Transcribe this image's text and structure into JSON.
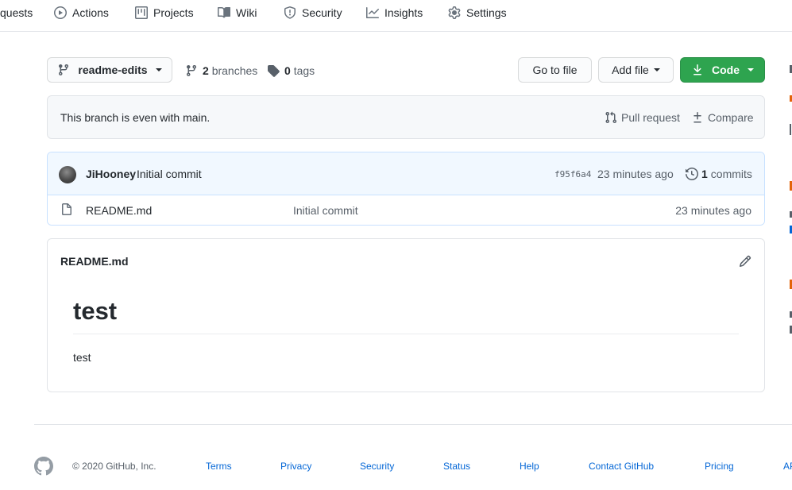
{
  "repo_nav": {
    "items": [
      {
        "label": "quests",
        "icon": "pull-request-icon"
      },
      {
        "label": "Actions",
        "icon": "play-icon"
      },
      {
        "label": "Projects",
        "icon": "project-icon"
      },
      {
        "label": "Wiki",
        "icon": "book-icon"
      },
      {
        "label": "Security",
        "icon": "shield-icon"
      },
      {
        "label": "Insights",
        "icon": "graph-icon"
      },
      {
        "label": "Settings",
        "icon": "gear-icon"
      }
    ]
  },
  "file_nav": {
    "branch": "readme-edits",
    "branches_count": "2",
    "branches_label": "branches",
    "tags_count": "0",
    "tags_label": "tags",
    "go_to_file": "Go to file",
    "add_file": "Add file",
    "code": "Code"
  },
  "branch_status": {
    "text": "This branch is even with main.",
    "pull_request": "Pull request",
    "compare": "Compare"
  },
  "latest_commit": {
    "author": "JiHooney",
    "message": "Initial commit",
    "sha": "f95f6a4",
    "time": "23 minutes ago",
    "count": "1",
    "count_label": "commits"
  },
  "files": [
    {
      "name": "README.md",
      "commit": "Initial commit",
      "time": "23 minutes ago",
      "icon": "file-icon"
    }
  ],
  "readme": {
    "title": "README.md",
    "heading": "test",
    "body": "test"
  },
  "footer": {
    "copyright": "© 2020 GitHub, Inc.",
    "links": [
      "Terms",
      "Privacy",
      "Security",
      "Status",
      "Help",
      "Contact GitHub",
      "Pricing",
      "AP"
    ]
  },
  "colors": {
    "accent_green": "#2ea44f",
    "link_blue": "#0366d6",
    "commit_header_bg": "#f1f8ff"
  }
}
